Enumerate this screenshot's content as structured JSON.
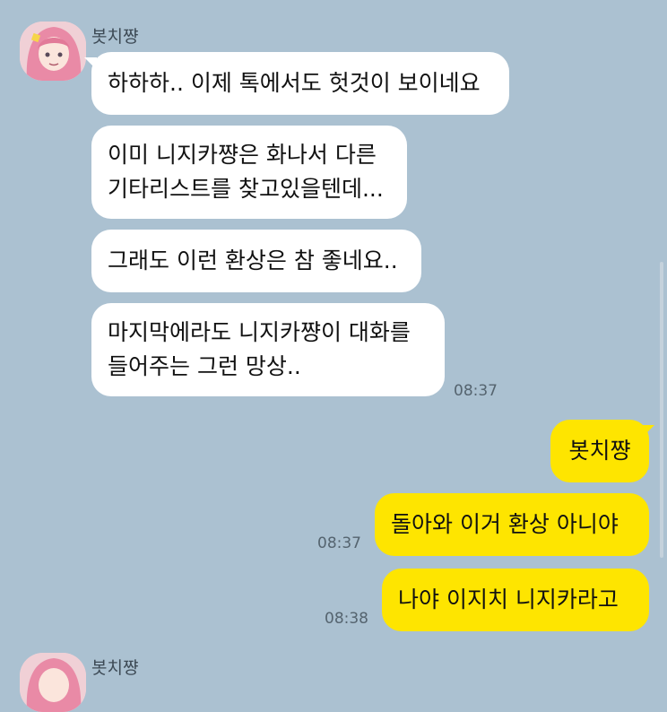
{
  "colors": {
    "background": "#abc1d1",
    "incoming_bubble": "#ffffff",
    "outgoing_bubble": "#fee500",
    "time_text": "#55646f",
    "name_text": "#3d4a55"
  },
  "messages": {
    "group1": {
      "sender": "봇치쨩",
      "avatar_icon": "pink-hair-avatar-icon",
      "bubbles": [
        "하하하.. 이제 톡에서도 헛것이 보이네요",
        "이미 니지카쨩은 화나서 다른\n기타리스트를 찾고있을텐데...",
        "그래도 이런 환상은 참 좋네요..",
        "마지막에라도 니지카쨩이 대화를\n들어주는 그런 망상.."
      ],
      "time": "08:37"
    },
    "outgoing": [
      {
        "text": "봇치쨩"
      },
      {
        "text": "돌아와 이거 환상 아니야",
        "time": "08:37"
      },
      {
        "text": "나야 이지치 니지카라고",
        "time": "08:38"
      }
    ],
    "group2": {
      "sender": "봇치쨩",
      "avatar_icon": "pink-hair-avatar-icon"
    }
  }
}
